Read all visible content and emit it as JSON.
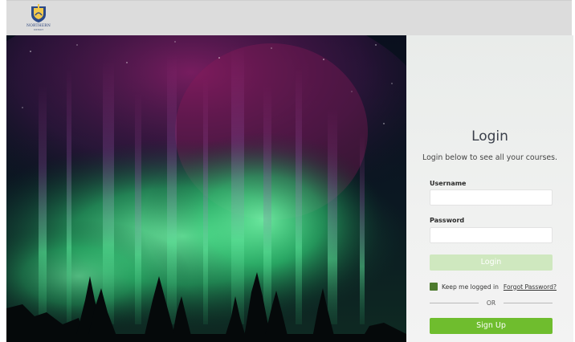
{
  "header": {
    "logo_icon": "school-district-logo-icon",
    "logo_text": "NORTHERN",
    "logo_subtext": "DISTRICT"
  },
  "hero": {
    "image": "aurora-borealis-over-forest"
  },
  "login": {
    "title": "Login",
    "subtitle": "Login below to see all your courses.",
    "username_label": "Username",
    "username_value": "",
    "password_label": "Password",
    "password_value": "",
    "login_button": "Login",
    "remember_label": "Keep me logged in",
    "remember_checked": true,
    "forgot_link": "Forgot Password?",
    "or_text": "OR",
    "signup_button": "Sign Up"
  },
  "colors": {
    "topbar": "#dcdcdc",
    "panel": "#eeefee",
    "login_button": "#cfe8bf",
    "signup_button": "#6fbd2e",
    "checkbox": "#4d7a2e"
  }
}
